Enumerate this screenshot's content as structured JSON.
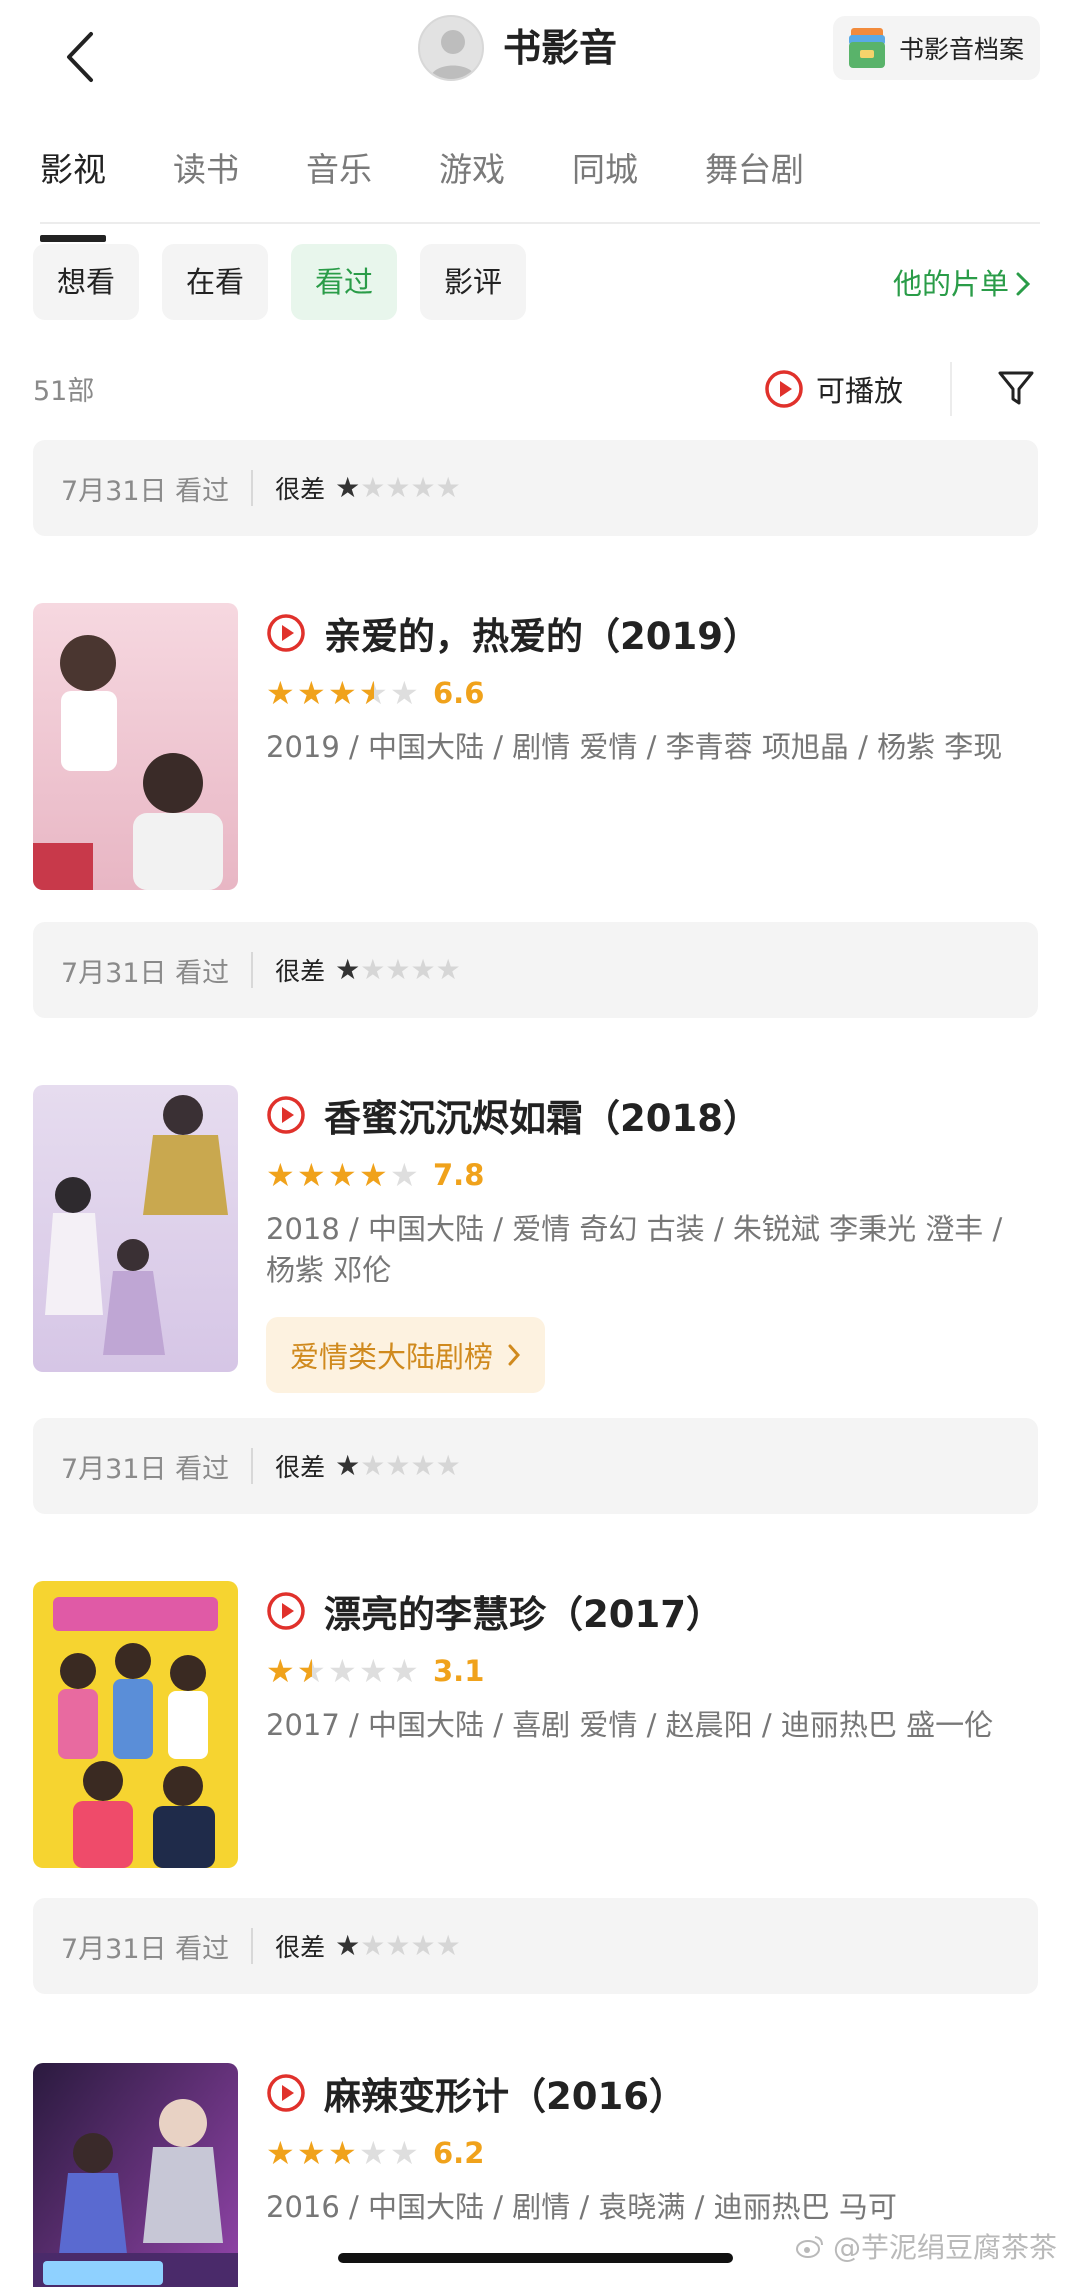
{
  "header": {
    "title": "书影音",
    "archive_label": "书影音档案"
  },
  "tabs": [
    {
      "label": "影视",
      "active": true
    },
    {
      "label": "读书"
    },
    {
      "label": "音乐"
    },
    {
      "label": "游戏"
    },
    {
      "label": "同城"
    },
    {
      "label": "舞台剧"
    }
  ],
  "chips": [
    {
      "label": "想看"
    },
    {
      "label": "在看"
    },
    {
      "label": "看过",
      "active": true
    },
    {
      "label": "影评"
    }
  ],
  "his_list_label": "他的片单",
  "count_label": "51部",
  "playable_label": "可播放",
  "ratings": [
    {
      "date": "7月31日 看过",
      "verdict": "很差",
      "stars": 1
    },
    {
      "date": "7月31日 看过",
      "verdict": "很差",
      "stars": 1
    },
    {
      "date": "7月31日 看过",
      "verdict": "很差",
      "stars": 1
    },
    {
      "date": "7月31日 看过",
      "verdict": "很差",
      "stars": 1
    }
  ],
  "items": [
    {
      "title": "亲爱的，热爱的（2019）",
      "rating": 3.5,
      "score": "6.6",
      "meta": "2019 / 中国大陆 / 剧情 爱情 / 李青蓉 项旭晶 / 杨紫 李现"
    },
    {
      "title": "香蜜沉沉烬如霜（2018）",
      "rating": 4,
      "score": "7.8",
      "meta": "2018 / 中国大陆 / 爱情 奇幻 古装 / 朱锐斌 李秉光 澄丰 / 杨紫 邓伦",
      "badge": "爱情类大陆剧榜"
    },
    {
      "title": "漂亮的李慧珍（2017）",
      "rating": 1.5,
      "score": "3.1",
      "meta": "2017 / 中国大陆 / 喜剧 爱情 / 赵晨阳 / 迪丽热巴 盛一伦"
    },
    {
      "title": "麻辣变形计（2016）",
      "rating": 3,
      "score": "6.2",
      "meta": "2016 / 中国大陆 / 剧情 / 袁晓满 / 迪丽热巴 马可"
    }
  ],
  "watermark": "@芋泥绢豆腐茶茶",
  "colors": {
    "accent_green": "#2a9c48",
    "star_orange": "#f0a21b",
    "play_red": "#e0312b",
    "badge_orange": "#d08a1e"
  }
}
